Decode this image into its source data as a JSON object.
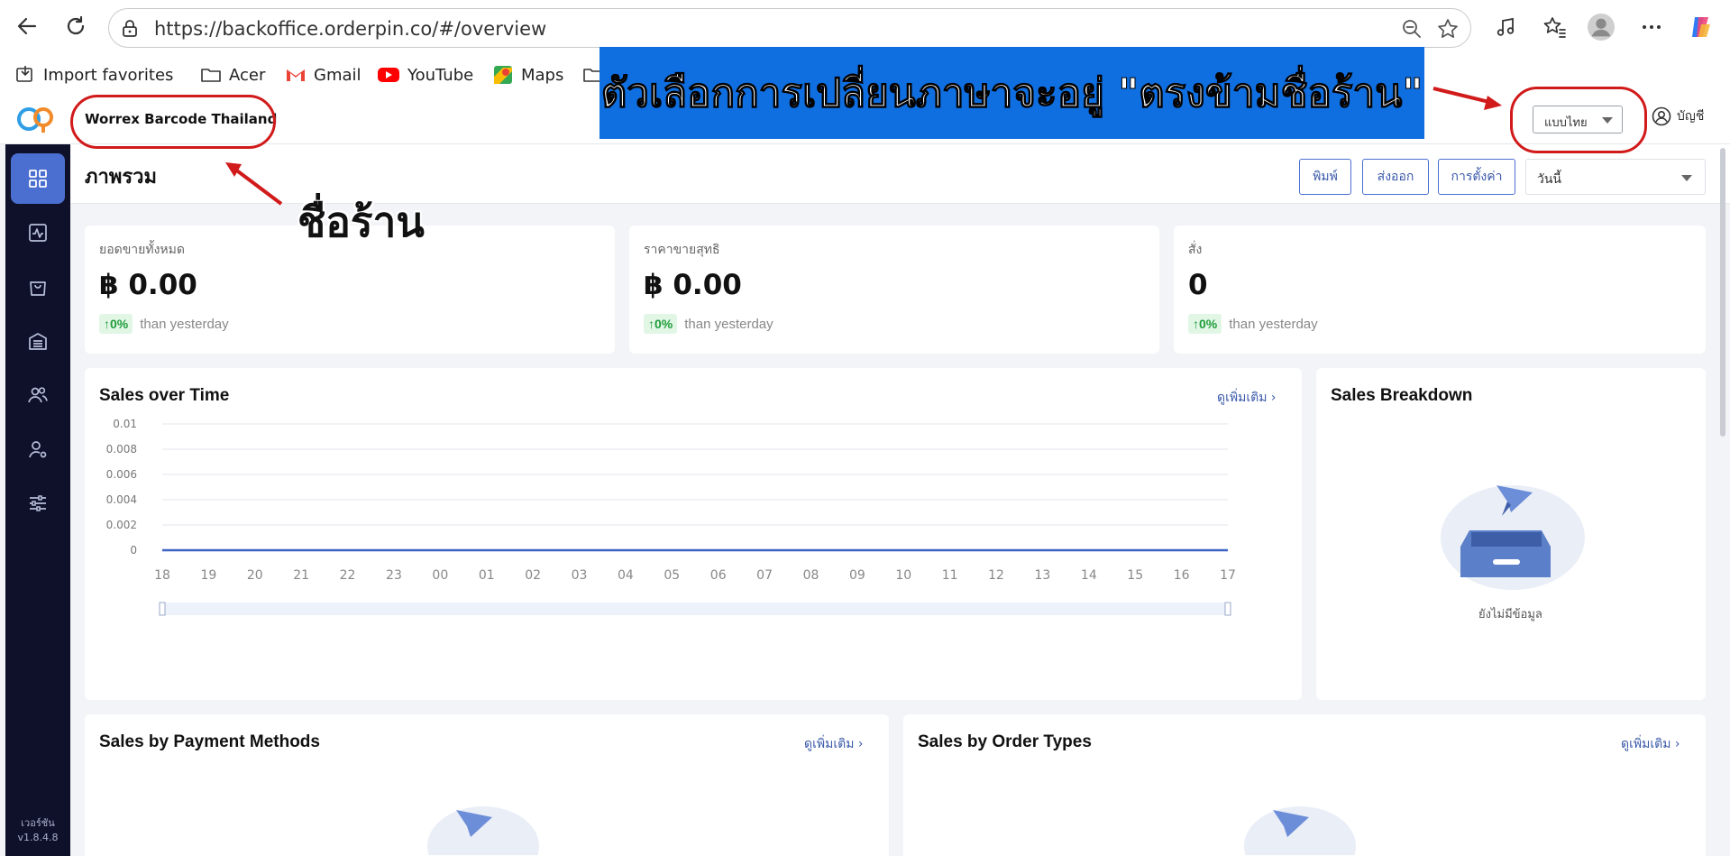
{
  "browser": {
    "url": "https://backoffice.orderpin.co/#/overview",
    "bookmarks": [
      "Import favorites",
      "Acer",
      "Gmail",
      "YouTube",
      "Maps"
    ]
  },
  "header": {
    "store_name": "Worrex Barcode Thailand",
    "language": "แบบไทย",
    "account": "บัญชี"
  },
  "sidebar": {
    "version_label": "เวอร์ชัน",
    "version": "v1.8.4.8"
  },
  "page": {
    "title": "ภาพรวม",
    "print_label": "พิมพ์",
    "export_label": "ส่งออก",
    "settings_label": "การตั้งค่า",
    "date_range": "วันนี้"
  },
  "stats": [
    {
      "label": "ยอดขายทั้งหมด",
      "value": "฿ 0.00",
      "change": "↑0%",
      "compare": "than yesterday"
    },
    {
      "label": "ราคาขายสุทธิ",
      "value": "฿ 0.00",
      "change": "↑0%",
      "compare": "than yesterday"
    },
    {
      "label": "สั่ง",
      "value": "0",
      "change": "↑0%",
      "compare": "than yesterday"
    }
  ],
  "sales_over_time": {
    "title": "Sales over Time",
    "more": "ดูเพิ่มเติม"
  },
  "sales_breakdown": {
    "title": "Sales Breakdown",
    "empty": "ยังไม่มีข้อมูล"
  },
  "payment_methods": {
    "title": "Sales by Payment Methods",
    "more": "ดูเพิ่มเติม"
  },
  "order_types": {
    "title": "Sales by Order Types",
    "more": "ดูเพิ่มเติม"
  },
  "annotations": {
    "banner": "ตัวเลือกการเปลี่ยนภาษาจะอยู่ \"ตรงข้ามชื่อร้าน\"",
    "store_label": "ชื่อร้าน"
  },
  "colors": {
    "accent": "#4a6fd0",
    "sidebar": "#0f1029",
    "annotation_red": "#d11a1a",
    "banner_blue": "#0f6ee0",
    "positive": "#1f9d3a"
  },
  "chart_data": {
    "type": "line",
    "title": "Sales over Time",
    "x": [
      "18",
      "19",
      "20",
      "21",
      "22",
      "23",
      "00",
      "01",
      "02",
      "03",
      "04",
      "05",
      "06",
      "07",
      "08",
      "09",
      "10",
      "11",
      "12",
      "13",
      "14",
      "15",
      "16",
      "17"
    ],
    "series": [
      {
        "values": [
          0,
          0,
          0,
          0,
          0,
          0,
          0,
          0,
          0,
          0,
          0,
          0,
          0,
          0,
          0,
          0,
          0,
          0,
          0,
          0,
          0,
          0,
          0,
          0
        ]
      }
    ],
    "yticks": [
      "0",
      "0.002",
      "0.004",
      "0.006",
      "0.008",
      "0.01"
    ],
    "ylim": [
      0,
      0.01
    ],
    "grid": true
  }
}
